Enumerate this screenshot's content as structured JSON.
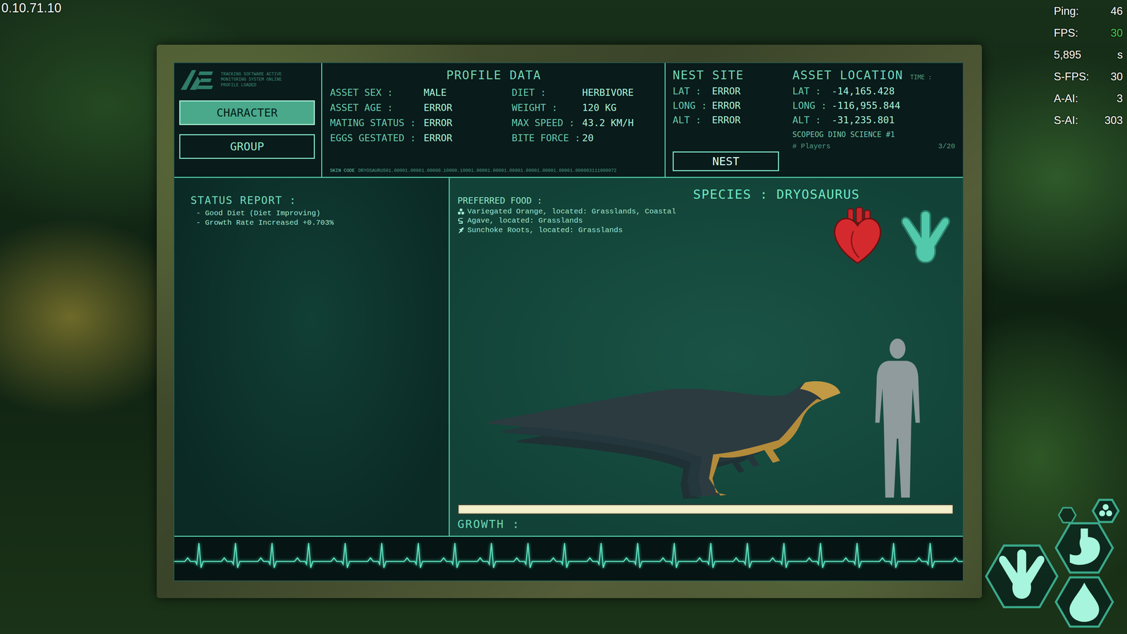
{
  "hud": {
    "version": "0.10.71.10",
    "stats": [
      {
        "label": "Ping:",
        "value": "46",
        "color": "#ffffff"
      },
      {
        "label": "FPS:",
        "value": "30",
        "color": "#3fd14a"
      },
      {
        "label": "5,895",
        "value": "s",
        "color": "#ffffff"
      },
      {
        "label": "S-FPS:",
        "value": "30",
        "color": "#ffffff"
      },
      {
        "label": "A-AI:",
        "value": "3",
        "color": "#ffffff"
      },
      {
        "label": "S-AI:",
        "value": "303",
        "color": "#ffffff"
      }
    ],
    "needs": [
      {
        "kind": "group",
        "level": 1
      },
      {
        "kind": "footprint",
        "level": 1
      },
      {
        "kind": "stomach",
        "level": 1
      },
      {
        "kind": "drop",
        "level": 1
      }
    ]
  },
  "panel": {
    "logo_lines": [
      "TRACKING SOFTWARE ACTIVE",
      "MONITORING SYSTEM ONLINE",
      "PROFILE LOADED"
    ],
    "tabs": [
      {
        "label": "CHARACTER",
        "selected": true
      },
      {
        "label": "GROUP",
        "selected": false
      }
    ],
    "profile": {
      "title": "PROFILE DATA",
      "fields": [
        {
          "label": "ASSET SEX :",
          "value": "MALE"
        },
        {
          "label": "DIET :",
          "value": "HERBIVORE"
        },
        {
          "label": "ASSET AGE :",
          "value": "ERROR"
        },
        {
          "label": "WEIGHT :",
          "value": "120 KG"
        },
        {
          "label": "MATING STATUS :",
          "value": "ERROR"
        },
        {
          "label": "MAX SPEED :",
          "value": "43.2 KM/H"
        },
        {
          "label": "EGGS GESTATED :",
          "value": "ERROR"
        },
        {
          "label": "BITE FORCE :",
          "value": "20"
        }
      ],
      "skin_label": "SKIN CODE",
      "skin_code": "DRYOSAURUS01.00001.00001.00000.10000.10001.00001.00001.00001.00001.00001.00001.000003111000072"
    },
    "nest": {
      "title": "NEST SITE",
      "fields": [
        {
          "label": "LAT :",
          "value": "ERROR"
        },
        {
          "label": "LONG :",
          "value": "ERROR"
        },
        {
          "label": "ALT :",
          "value": "ERROR"
        }
      ],
      "button": "NEST"
    },
    "location": {
      "title": "ASSET LOCATION",
      "time_label": "TIME :",
      "fields": [
        {
          "label": "LAT :",
          "value": "-14,165.428"
        },
        {
          "label": "LONG :",
          "value": "-116,955.844"
        },
        {
          "label": "ALT :",
          "value": "-31,235.801"
        }
      ],
      "server": "SCOPEOG DINO SCIENCE #1",
      "players_label": "# Players",
      "players": "3/20"
    },
    "status": {
      "title": "STATUS REPORT :",
      "lines": [
        "- Good Diet (Diet Improving)",
        "- Growth Rate Increased +0.703%"
      ]
    },
    "food": {
      "title": "PREFERRED FOOD :",
      "items": [
        {
          "kind": "fruit",
          "text": "Variegated Orange, located: Grasslands, Coastal"
        },
        {
          "kind": "agave",
          "text": "Agave, located: Grasslands"
        },
        {
          "kind": "root",
          "text": "Sunchoke Roots, located: Grasslands"
        }
      ]
    },
    "species": "SPECIES : DRYOSAURUS",
    "growth": {
      "label": "GROWTH :",
      "level": 1
    }
  }
}
